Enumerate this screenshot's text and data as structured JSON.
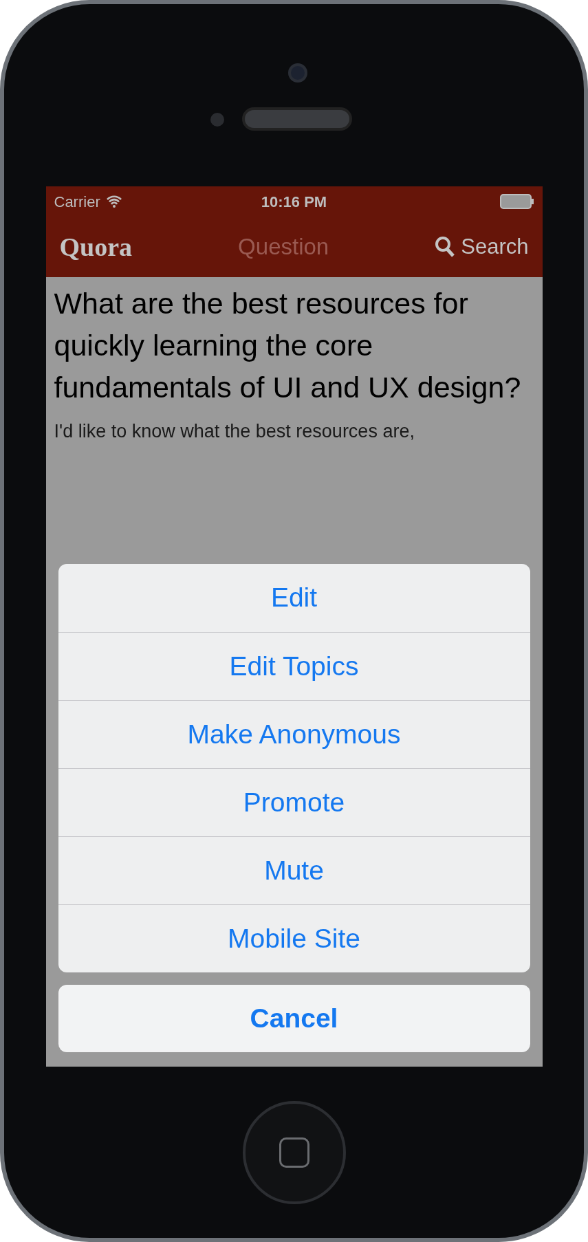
{
  "status_bar": {
    "carrier": "Carrier",
    "time": "10:16 PM"
  },
  "nav_bar": {
    "logo": "Quora",
    "title": "Question",
    "search": "Search"
  },
  "question": {
    "title": "What are the best resources for quickly learning the core fundamentals of UI and UX design?",
    "details": "I'd like to know what the best resources are,"
  },
  "action_sheet": {
    "items": [
      "Edit",
      "Edit Topics",
      "Make Anonymous",
      "Promote",
      "Mute",
      "Mobile Site"
    ],
    "cancel": "Cancel"
  }
}
